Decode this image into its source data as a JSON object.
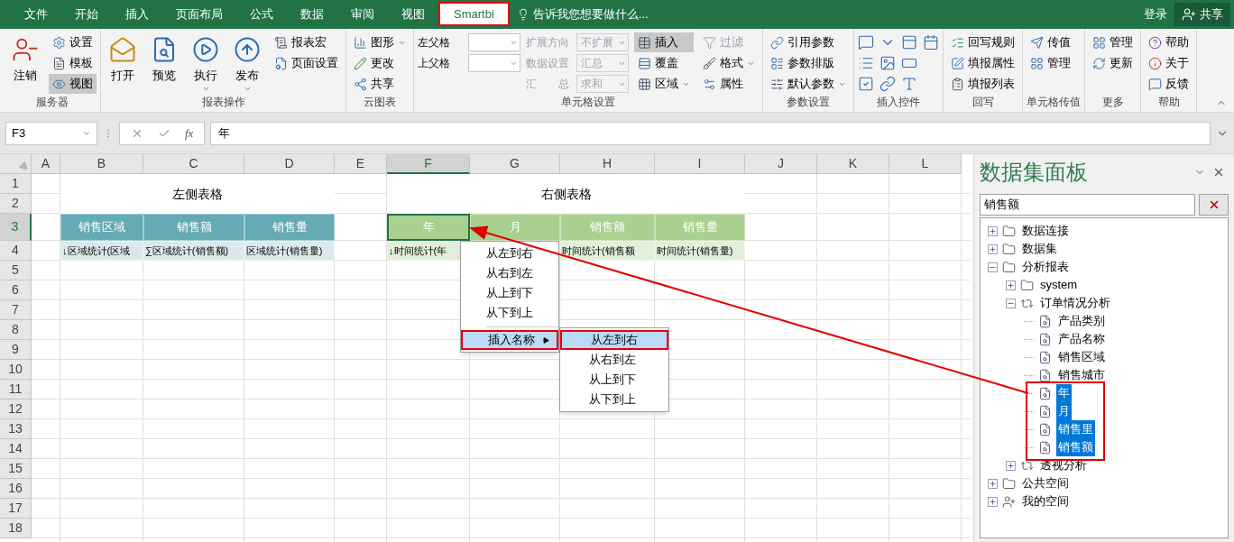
{
  "menu_tabs": [
    {
      "label": "文件",
      "selected": false
    },
    {
      "label": "开始",
      "selected": false
    },
    {
      "label": "插入",
      "selected": false
    },
    {
      "label": "页面布局",
      "selected": false
    },
    {
      "label": "公式",
      "selected": false
    },
    {
      "label": "数据",
      "selected": false
    },
    {
      "label": "审阅",
      "selected": false
    },
    {
      "label": "视图",
      "selected": false
    },
    {
      "label": "Smartbi",
      "selected": true
    }
  ],
  "tell_me": {
    "placeholder": "告诉我您想要做什么..."
  },
  "account": {
    "login": "登录",
    "share": "共享"
  },
  "ribbon": [
    {
      "label": "服务器",
      "kind": "buttons",
      "columns": [
        [
          {
            "kind": "large",
            "label": "注销"
          }
        ],
        [
          {
            "kind": "small",
            "label": "设置",
            "on": false
          },
          {
            "kind": "small",
            "label": "模板",
            "on": false
          },
          {
            "kind": "small",
            "label": "视图",
            "on": true
          }
        ]
      ]
    },
    {
      "label": "报表操作",
      "kind": "buttons",
      "columns": [
        [
          {
            "kind": "large",
            "label": "打开"
          }
        ],
        [
          {
            "kind": "large",
            "label": "预览"
          }
        ],
        [
          {
            "kind": "large",
            "label": "执行",
            "dropdown": true
          }
        ],
        [
          {
            "kind": "large",
            "label": "发布",
            "dropdown": true
          }
        ],
        [
          {
            "kind": "small",
            "label": "报表宏",
            "on": false
          },
          {
            "kind": "small",
            "label": "页面设置",
            "on": false
          }
        ]
      ]
    },
    {
      "label": "云图表",
      "kind": "buttons",
      "columns": [
        [
          {
            "kind": "small",
            "label": "图形",
            "on": false,
            "dropdown": true
          },
          {
            "kind": "small",
            "label": "更改",
            "on": false
          },
          {
            "kind": "small",
            "label": "共享",
            "on": false
          }
        ]
      ]
    },
    {
      "label": "单元格设置",
      "kind": "buttons",
      "columns": [
        [
          {
            "kind": "field",
            "label": "左父格",
            "disabled": false
          },
          {
            "kind": "field",
            "label": "上父格",
            "disabled": false
          }
        ],
        [
          {
            "kind": "field",
            "label": "扩展方向",
            "value": "不扩展",
            "disabled": true
          },
          {
            "kind": "field",
            "label": "数据设置",
            "value": "汇总",
            "disabled": true
          },
          {
            "kind": "field",
            "label": "汇　　总",
            "value": "求和",
            "disabled": true
          }
        ],
        [
          {
            "kind": "small",
            "label": "插入",
            "on": true
          },
          {
            "kind": "small",
            "label": "覆盖",
            "on": false
          },
          {
            "kind": "small",
            "label": "区域",
            "on": false,
            "dropdown": true
          }
        ],
        [
          {
            "kind": "small",
            "label": "过滤",
            "on": false,
            "disabled": true
          },
          {
            "kind": "small",
            "label": "格式",
            "on": false,
            "disabled": false,
            "dropdown": true
          },
          {
            "kind": "small",
            "label": "属性",
            "on": false,
            "disabled": false
          }
        ]
      ]
    },
    {
      "label": "参数设置",
      "kind": "buttons",
      "columns": [
        [
          {
            "kind": "small",
            "label": "引用参数",
            "on": false
          },
          {
            "kind": "small",
            "label": "参数排版",
            "on": false
          },
          {
            "kind": "small",
            "label": "默认参数",
            "on": false,
            "dropdown": true
          }
        ]
      ]
    },
    {
      "label": "插入控件",
      "kind": "controls"
    },
    {
      "label": "回写",
      "kind": "buttons",
      "columns": [
        [
          {
            "kind": "small",
            "label": "回写规则",
            "on": false
          },
          {
            "kind": "small",
            "label": "填报属性",
            "on": false
          },
          {
            "kind": "small",
            "label": "填报列表",
            "on": false
          }
        ]
      ]
    },
    {
      "label": "单元格传值",
      "kind": "buttons",
      "columns": [
        [
          {
            "kind": "small",
            "label": "传值",
            "on": false
          },
          {
            "kind": "small",
            "label": "管理",
            "on": false
          }
        ]
      ]
    },
    {
      "label": "更多",
      "kind": "buttons",
      "columns": [
        [
          {
            "kind": "small",
            "label": "管理",
            "on": false
          },
          {
            "kind": "small",
            "label": "更新",
            "on": false
          }
        ]
      ]
    },
    {
      "label": "帮助",
      "kind": "buttons",
      "columns": [
        [
          {
            "kind": "small",
            "label": "帮助",
            "on": false
          },
          {
            "kind": "small",
            "label": "关于",
            "on": false
          },
          {
            "kind": "small",
            "label": "反馈",
            "on": false
          }
        ]
      ]
    }
  ],
  "formula_bar": {
    "name_box": "F3",
    "fx": "fx",
    "value": "年"
  },
  "sheet": {
    "columns": [
      {
        "label": "A",
        "selected": false
      },
      {
        "label": "B",
        "selected": false
      },
      {
        "label": "C",
        "selected": false
      },
      {
        "label": "D",
        "selected": false
      },
      {
        "label": "E",
        "selected": false
      },
      {
        "label": "F",
        "selected": true
      },
      {
        "label": "G",
        "selected": false
      },
      {
        "label": "H",
        "selected": false
      },
      {
        "label": "I",
        "selected": false
      },
      {
        "label": "J",
        "selected": false
      },
      {
        "label": "K",
        "selected": false
      },
      {
        "label": "L",
        "selected": false
      }
    ],
    "rows": [
      {
        "label": "1",
        "selected": false
      },
      {
        "label": "2",
        "selected": false
      },
      {
        "label": "3",
        "selected": true
      },
      {
        "label": "4",
        "selected": false
      },
      {
        "label": "5",
        "selected": false
      },
      {
        "label": "6",
        "selected": false
      },
      {
        "label": "7",
        "selected": false
      },
      {
        "label": "8",
        "selected": false
      },
      {
        "label": "9",
        "selected": false
      },
      {
        "label": "10",
        "selected": false
      },
      {
        "label": "11",
        "selected": false
      },
      {
        "label": "12",
        "selected": false
      },
      {
        "label": "13",
        "selected": false
      },
      {
        "label": "14",
        "selected": false
      },
      {
        "label": "15",
        "selected": false
      },
      {
        "label": "16",
        "selected": false
      },
      {
        "label": "17",
        "selected": false
      },
      {
        "label": "18",
        "selected": false
      }
    ],
    "cells": [
      {
        "kind": "title",
        "text": "左侧表格",
        "selected": false
      },
      {
        "kind": "title",
        "text": "右侧表格",
        "selected": false
      },
      {
        "kind": "teal_header",
        "text": "销售区域",
        "selected": false
      },
      {
        "kind": "teal_header",
        "text": "销售额",
        "selected": false
      },
      {
        "kind": "teal_header",
        "text": "销售量",
        "selected": false
      },
      {
        "kind": "green_header",
        "text": "年",
        "selected": true
      },
      {
        "kind": "green_header",
        "text": "月",
        "selected": false
      },
      {
        "kind": "green_header",
        "text": "销售额",
        "selected": false
      },
      {
        "kind": "green_header",
        "text": "销售量",
        "selected": false
      },
      {
        "kind": "teal_field",
        "text": "↓区域统计(区域",
        "selected": false
      },
      {
        "kind": "teal_field",
        "text": "∑区域统计(销售额)",
        "selected": false
      },
      {
        "kind": "teal_field",
        "text": "区域统计(销售量)",
        "selected": false
      },
      {
        "kind": "green_field",
        "text": "↓时间统计(年",
        "selected": false
      },
      {
        "kind": "green_field",
        "selected": false
      },
      {
        "kind": "green_field",
        "text": "时间统计(销售额",
        "selected": false
      },
      {
        "kind": "green_field",
        "text": "时间统计(销售量)",
        "selected": false
      }
    ]
  },
  "context_menu": {
    "items": [
      {
        "label": "从左到右",
        "selected": false
      },
      {
        "label": "从右到左",
        "selected": false
      },
      {
        "label": "从上到下",
        "selected": false
      },
      {
        "label": "从下到上",
        "selected": false
      },
      {
        "label": "插入名称",
        "selected": true,
        "submenu": true
      }
    ],
    "submenu": [
      {
        "label": "从左到右",
        "selected": true
      },
      {
        "label": "从右到左",
        "selected": false
      },
      {
        "label": "从上到下",
        "selected": false
      },
      {
        "label": "从下到上",
        "selected": false
      }
    ]
  },
  "dataset_panel": {
    "title": "数据集面板",
    "search": "销售额",
    "tree": [
      {
        "label": "数据连接",
        "kind": "folder",
        "expanded": false
      },
      {
        "label": "数据集",
        "kind": "folder",
        "expanded": false
      },
      {
        "label": "分析报表",
        "kind": "folder",
        "expanded": true,
        "children": [
          {
            "label": "system",
            "kind": "folder",
            "expanded": false
          },
          {
            "label": "订单情况分析",
            "kind": "report",
            "expanded": true,
            "children": [
              {
                "label": "产品类别",
                "kind": "field",
                "selected": false
              },
              {
                "label": "产品名称",
                "kind": "field",
                "selected": false
              },
              {
                "label": "销售区域",
                "kind": "field",
                "selected": false
              },
              {
                "label": "销售城市",
                "kind": "field",
                "selected": false
              },
              {
                "label": "年",
                "kind": "field",
                "selected": true
              },
              {
                "label": "月",
                "kind": "field",
                "selected": true
              },
              {
                "label": "销售里",
                "kind": "field",
                "selected": true
              },
              {
                "label": "销售额",
                "kind": "field",
                "selected": true
              }
            ]
          },
          {
            "label": "透视分析",
            "kind": "report",
            "expanded": false
          }
        ]
      },
      {
        "label": "公共空间",
        "kind": "folder",
        "expanded": false
      },
      {
        "label": "我的空间",
        "kind": "space",
        "expanded": false
      }
    ]
  }
}
